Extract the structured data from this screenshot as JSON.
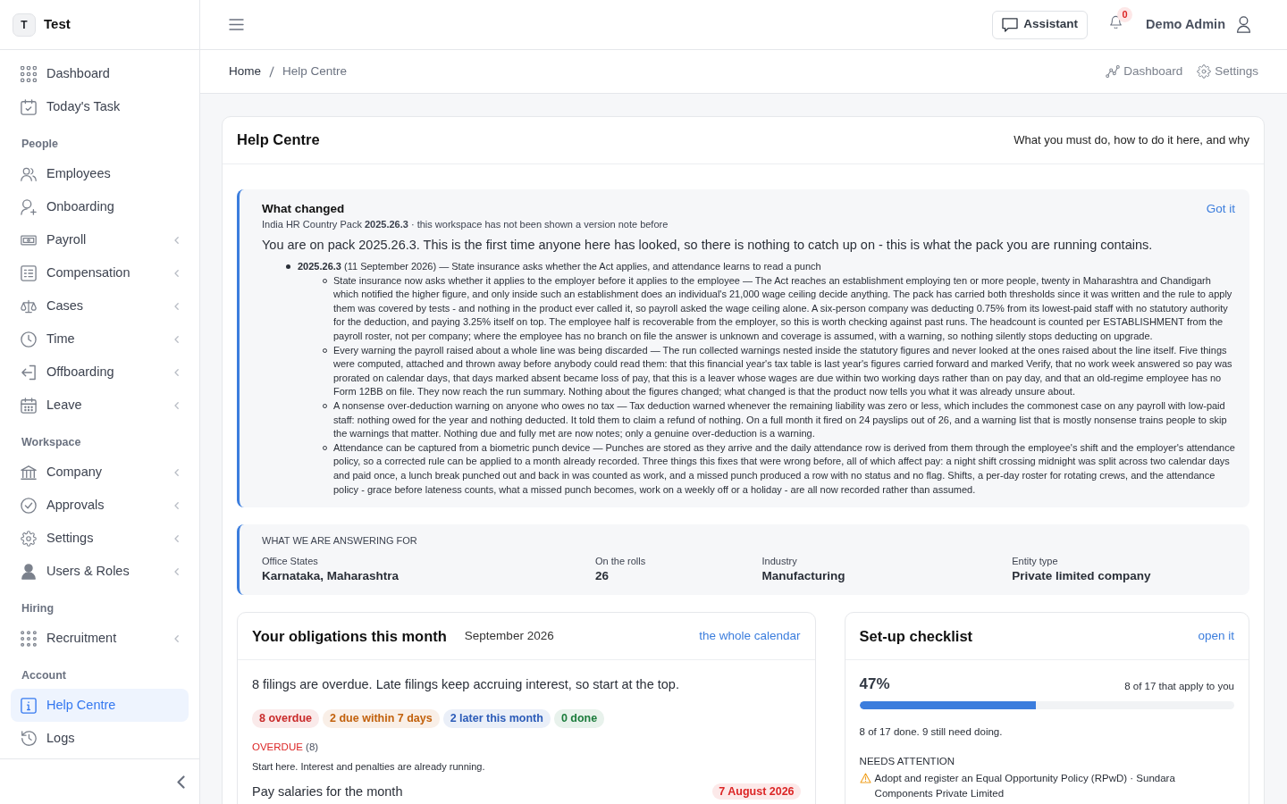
{
  "sidebar": {
    "brand": {
      "initial": "T",
      "name": "Test"
    },
    "sections": [
      {
        "items": [
          {
            "label": "Dashboard",
            "selected": false,
            "submenu": false
          },
          {
            "label": "Today's Task",
            "selected": false,
            "submenu": false
          }
        ]
      },
      {
        "heading": "People",
        "items": [
          {
            "label": "Employees",
            "selected": false,
            "submenu": false
          },
          {
            "label": "Onboarding",
            "selected": false,
            "submenu": false
          },
          {
            "label": "Payroll",
            "selected": false,
            "submenu": true
          },
          {
            "label": "Compensation",
            "selected": false,
            "submenu": true
          },
          {
            "label": "Cases",
            "selected": false,
            "submenu": true
          },
          {
            "label": "Time",
            "selected": false,
            "submenu": true
          },
          {
            "label": "Offboarding",
            "selected": false,
            "submenu": true
          },
          {
            "label": "Leave",
            "selected": false,
            "submenu": true
          }
        ]
      },
      {
        "heading": "Workspace",
        "items": [
          {
            "label": "Company",
            "selected": false,
            "submenu": true
          },
          {
            "label": "Approvals",
            "selected": false,
            "submenu": true
          },
          {
            "label": "Settings",
            "selected": false,
            "submenu": true
          },
          {
            "label": "Users & Roles",
            "selected": false,
            "submenu": true
          }
        ]
      },
      {
        "heading": "Hiring",
        "items": [
          {
            "label": "Recruitment",
            "selected": false,
            "submenu": true
          }
        ]
      },
      {
        "heading": "Account",
        "items": [
          {
            "label": "Help Centre",
            "selected": true,
            "submenu": false
          },
          {
            "label": "Logs",
            "selected": false,
            "submenu": false
          }
        ]
      }
    ]
  },
  "topbar": {
    "assistant_button": "Assistant",
    "notifications": {
      "count": "0"
    },
    "user": "Demo Admin"
  },
  "breadcrumb": {
    "items": [
      "Home",
      "Help Centre"
    ],
    "actions": [
      "Dashboard",
      "Settings"
    ]
  },
  "page": {
    "title": "Help Centre",
    "subtitle": "What you must do, how to do it here, and why"
  },
  "what_changed": {
    "title": "What changed",
    "meta": "India HR Country Pack **2025.26.3** · this workspace has not been shown a version note before",
    "dismiss": "Got it",
    "intro": "You are on pack 2025.26.3. This is the first time anyone here has looked, so there is nothing to catch up on - this is what the pack you are running contains.",
    "items": [
      {
        "text": "**2025.26.3** (11 September 2026) — State insurance asks whether the Act applies, and attendance learns to read a punch",
        "children": [
          {
            "text": "State insurance now asks whether it applies to the employer before it applies to the employee — The Act reaches an establishment employing ten or more people, twenty in Maharashtra and Chandigarh which notified the higher figure, and only inside such an establishment does an individual's 21,000 wage ceiling decide anything. The pack has carried both thresholds since it was written and the rule to apply them was covered by tests - and nothing in the product ever called it, so payroll asked the wage ceiling alone. A six-person company was deducting 0.75% from its lowest-paid staff with no statutory authority for the deduction, and paying 3.25% itself on top. The employee half is recoverable from the employer, so this is worth checking against past runs. The headcount is counted per ESTABLISHMENT from the payroll roster, not per company; where the employee has no branch on file the answer is unknown and coverage is assumed, with a warning, so nothing silently stops deducting on upgrade."
          },
          {
            "text": "Every warning the payroll raised about a whole line was being discarded — The run collected warnings nested inside the statutory figures and never looked at the ones raised about the line itself. Five things were computed, attached and thrown away before anybody could read them: that this financial year's tax table is last year's figures carried forward and marked Verify, that no work week answered so pay was prorated on calendar days, that days marked absent became loss of pay, that this is a leaver whose wages are due within two working days rather than on pay day, and that an old-regime employee has no Form 12BB on file. They now reach the run summary. Nothing about the figures changed; what changed is that the product now tells you what it was already unsure about."
          },
          {
            "text": "A nonsense over-deduction warning on anyone who owes no tax — Tax deduction warned whenever the remaining liability was zero or less, which includes the commonest case on any payroll with low-paid staff: nothing owed for the year and nothing deducted. It told them to claim a refund of nothing. On a full month it fired on 24 payslips out of 26, and a warning list that is mostly nonsense trains people to skip the warnings that matter. Nothing due and fully met are now notes; only a genuine over-deduction is a warning."
          },
          {
            "text": "Attendance can be captured from a biometric punch device — Punches are stored as they arrive and the daily attendance row is derived from them through the employee's shift and the employer's attendance policy, so a corrected rule can be applied to a month already recorded. Three things this fixes that were wrong before, all of which affect pay: a night shift crossing midnight was split across two calendar days and paid once, a lunch break punched out and back in was counted as work, and a missed punch produced a row with no status and no flag. Shifts, a per-day roster for rotating crews, and the attendance policy - grace before lateness counts, what a missed punch becomes, work on a weekly off or a holiday - are all now recorded rather than assumed."
          }
        ]
      }
    ]
  },
  "context": {
    "heading": "WHAT WE ARE ANSWERING FOR",
    "fields": [
      {
        "label": "Office States",
        "value": "Karnataka, Maharashtra"
      },
      {
        "label": "On the rolls",
        "value": "26"
      },
      {
        "label": "Industry",
        "value": "Manufacturing"
      },
      {
        "label": "Entity type",
        "value": "Private limited company"
      }
    ]
  },
  "obligations": {
    "title": "Your obligations this month",
    "period": "September 2026",
    "link": "the whole calendar",
    "summary": "8 filings are overdue. Late filings keep accruing interest, so start at the top.",
    "tags": [
      {
        "label": "8 overdue",
        "color": "#c92a2a"
      },
      {
        "label": "2 due within 7 days",
        "color": "#c2610c"
      },
      {
        "label": "2 later this month",
        "color": "#2b5bb8"
      },
      {
        "label": "0 done",
        "color": "#1c7c3c"
      }
    ],
    "groups": [
      {
        "label": "OVERDUE",
        "count": "(8)",
        "color": "#dc2626",
        "note": "Start here. Interest and penalties are already running.",
        "items": [
          {
            "title": "Pay salaries for the month",
            "due": "7 August 2026"
          }
        ]
      }
    ]
  },
  "checklist": {
    "title": "Set-up checklist",
    "link": "open it",
    "percent": "47%",
    "scope": "8 of 17 that apply to you",
    "level": 0.47,
    "summary": "8 of 17 done. 9 still need doing.",
    "attention_heading": "NEEDS ATTENTION",
    "attention_items": [
      {
        "text": "Adopt and register an Equal Opportunity Policy (RPwD) · Sundara Components Private Limited"
      }
    ]
  }
}
